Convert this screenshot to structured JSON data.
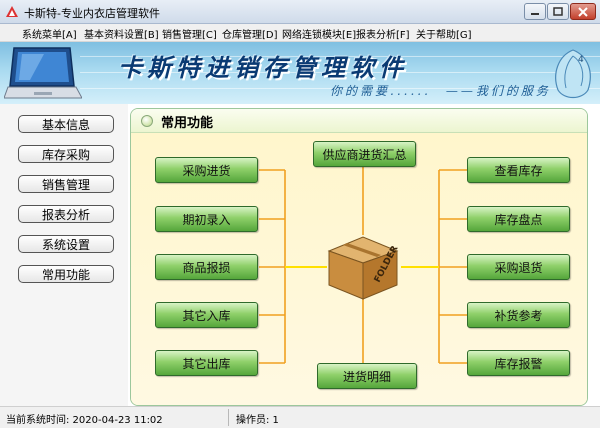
{
  "window": {
    "title": "卡斯特-专业内衣店管理软件"
  },
  "menu": [
    "系统菜单[A]",
    "基本资料设置[B]",
    "销售管理[C]",
    "仓库管理[D]",
    "网络连锁模块[E]",
    "报表分析[F]",
    "关于帮助[G]"
  ],
  "banner": {
    "title": "卡斯特进销存管理软件",
    "slogan": "你的需要......　——我们的服务"
  },
  "sidebar": [
    "基本信息",
    "库存采购",
    "销售管理",
    "报表分析",
    "系统设置",
    "常用功能"
  ],
  "panel": {
    "title": "常用功能"
  },
  "functions": {
    "left": [
      "采购进货",
      "期初录入",
      "商品报损",
      "其它入库",
      "其它出库"
    ],
    "top": "供应商进货汇总",
    "bottom": "进货明细",
    "right": [
      "查看库存",
      "库存盘点",
      "采购退货",
      "补货参考",
      "库存报警"
    ]
  },
  "center_box": {
    "label": "FOLDER"
  },
  "status": {
    "time_label": "当前系统时间: 2020-04-23 11:02",
    "operator_label": "操作员: 1"
  },
  "colors": {
    "button_green": "#7ac35a",
    "panel_background": "#fff6cc",
    "banner_blue": "#9bd3ee",
    "connector_orange": "#f0a020",
    "close_red": "#c84a38"
  }
}
